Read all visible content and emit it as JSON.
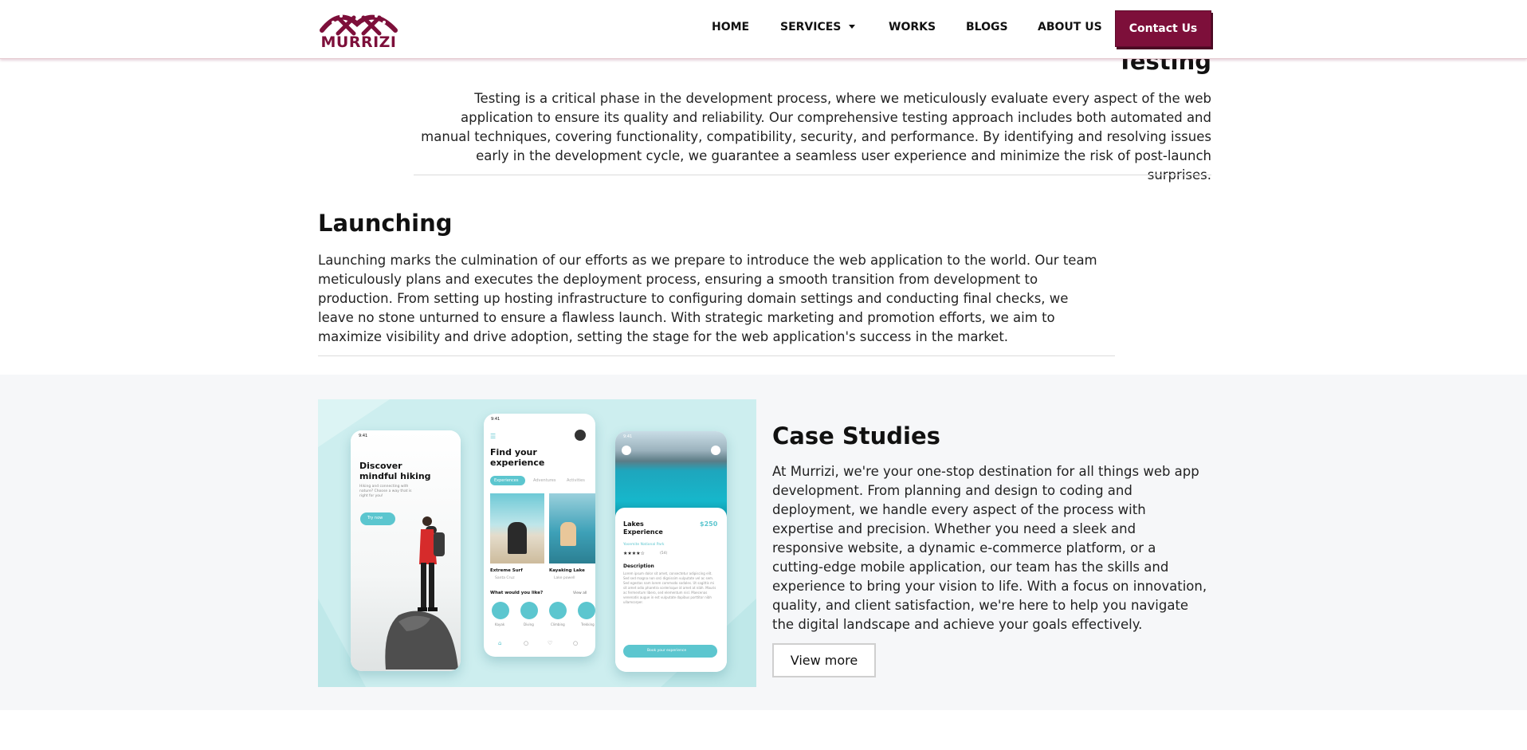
{
  "header": {
    "logo_text": "MURRIZI",
    "nav": {
      "home": "HOME",
      "services": "SERVICES",
      "works": "WORKS",
      "blogs": "BLOGS",
      "about": "ABOUT US"
    },
    "contact_label": "Contact Us",
    "accent_color": "#7d0f3a"
  },
  "testing": {
    "title": "Testing",
    "text": "Testing is a critical phase in the development process, where we meticulously evaluate every aspect of the web application to ensure its quality and reliability. Our comprehensive testing approach includes both automated and manual techniques, covering functionality, compatibility, security, and performance. By identifying and resolving issues early in the development cycle, we guarantee a seamless user experience and minimize the risk of post-launch surprises."
  },
  "launching": {
    "title": "Launching",
    "text": "Launching marks the culmination of our efforts as we prepare to introduce the web application to the world. Our team meticulously plans and executes the deployment process, ensuring a smooth transition from development to production. From setting up hosting infrastructure to configuring domain settings and conducting final checks, we leave no stone unturned to ensure a flawless launch. With strategic marketing and promotion efforts, we aim to maximize visibility and drive adoption, setting the stage for the web application's success in the market."
  },
  "case_studies": {
    "title": "Case Studies",
    "text": "At Murrizi, we're your one-stop destination for all things web app development. From planning and design to coding and deployment, we handle every aspect of the process with expertise and precision. Whether you need a sleek and responsive website, a dynamic e-commerce platform, or a cutting-edge mobile application, our team has the skills and experience to bring your vision to life. With a focus on innovation, quality, and client satisfaction, we're here to help you navigate the digital landscape and achieve your goals effectively.",
    "button_label": "View more",
    "mockup": {
      "phone1": {
        "time": "9:41",
        "title_line1": "Discover",
        "title_line2": "mindful hiking",
        "subtitle": "Hiking and connecting with nature? Choose a way that is right for you!",
        "button": "Try now"
      },
      "phone2": {
        "time": "9:41",
        "title_line1": "Find your",
        "title_line2": "experience",
        "tabs": [
          "Experiences",
          "Adventures",
          "Activities"
        ],
        "card1": "Extreme Surf",
        "card1_loc": "Santa Cruz",
        "card2": "Kayaking Lake",
        "card2_loc": "Lake powell",
        "question": "What would you like?",
        "view_all": "View all",
        "activities": [
          "Kayak",
          "Diving",
          "Climbing",
          "Trekking"
        ]
      },
      "phone3": {
        "time": "9:41",
        "title_line1": "Lakes",
        "title_line2": "Experience",
        "price": "$250",
        "location": "Yosemite National Park",
        "rating_count": "(54)",
        "description_label": "Description",
        "description": "Lorem ipsum dolor sit amet, consectetur adipiscing elit. Sed sed magna non orci dignissim vulputate vel ac sem. Sed egestas nam lorem commodo sodales. Ut sagittis mi sit amet odio pharetra scelerisque id amet at nibh. Mauris ac fermentum libero, sed elementum nisl. Maecenas venenatis augue in est vulputate dapibus porttitor nibh ullamcorper.",
        "book_button": "Book your experience"
      }
    }
  }
}
